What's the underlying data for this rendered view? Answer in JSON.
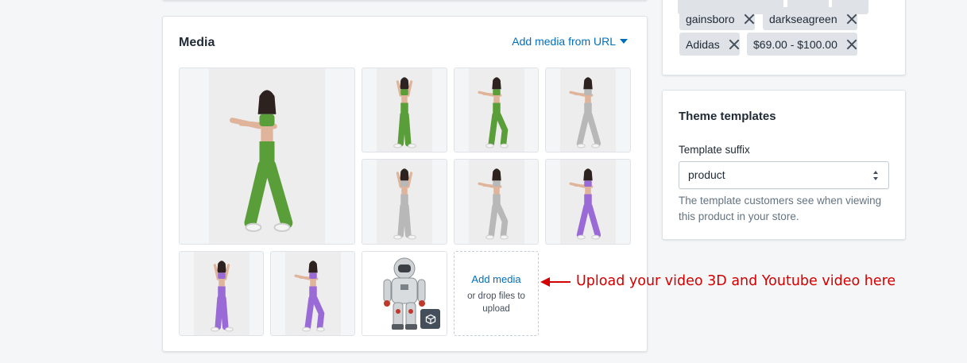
{
  "media": {
    "title": "Media",
    "add_from_url": "Add media from URL",
    "add_media_label": "Add media",
    "add_media_sub": "or drop files to upload",
    "tiles": [
      {
        "outfit": "green",
        "pose": "stretch"
      },
      {
        "outfit": "green",
        "pose": "arms-up"
      },
      {
        "outfit": "green",
        "pose": "step"
      },
      {
        "outfit": "grey",
        "pose": "stretch"
      },
      {
        "outfit": "grey",
        "pose": "arms-up"
      },
      {
        "outfit": "grey",
        "pose": "step"
      },
      {
        "outfit": "purple",
        "pose": "stretch"
      },
      {
        "outfit": "purple",
        "pose": "arms-up"
      },
      {
        "outfit": "purple",
        "pose": "step"
      },
      {
        "outfit": "3d-astronaut",
        "pose": "model",
        "badge_icon": "cube-icon"
      }
    ]
  },
  "tags": {
    "items": [
      {
        "label": "gainsboro"
      },
      {
        "label": "darkseagreen"
      },
      {
        "label": "Adidas"
      },
      {
        "label": "$69.00 - $100.00"
      }
    ]
  },
  "theme": {
    "title": "Theme templates",
    "suffix_label": "Template suffix",
    "suffix_value": "product",
    "help": "The template customers see when viewing this product in your store."
  },
  "annotation": {
    "text": "Upload your video 3D and Youtube video here",
    "color": "#d40000"
  },
  "colors": {
    "link": "#006fbb",
    "green": "#5a9e3a",
    "grey": "#b8b8b8",
    "purple": "#9a6ad6"
  }
}
